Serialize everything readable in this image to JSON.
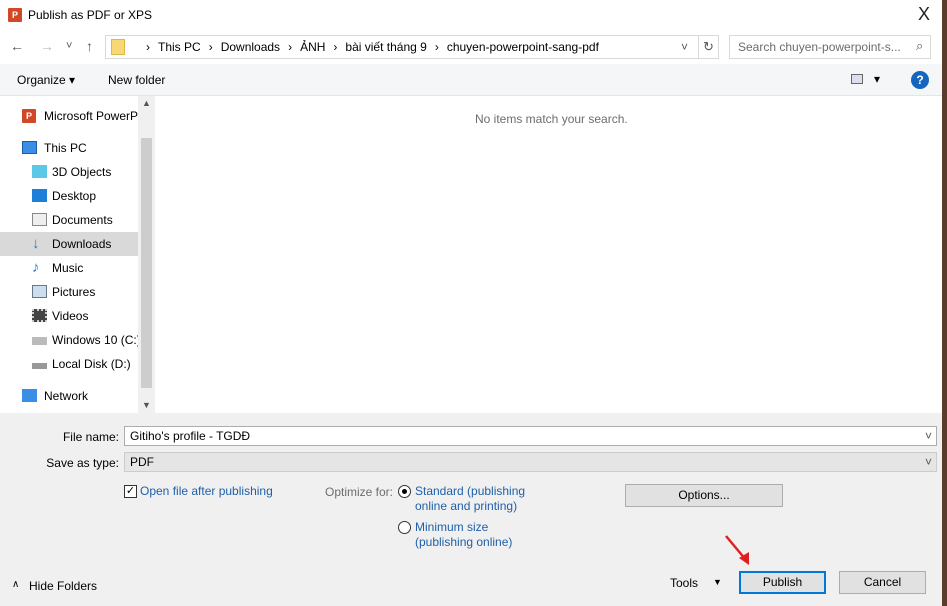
{
  "window": {
    "title": "Publish as PDF or XPS",
    "close": "X"
  },
  "nav": {
    "back": "←",
    "forward": "→",
    "recent": "˅",
    "up": "↑",
    "refresh": "↻",
    "dropdown": "˅",
    "breadcrumb": [
      "This PC",
      "Downloads",
      "ẢNH",
      "bài viết tháng 9",
      "chuyen-powerpoint-sang-pdf"
    ],
    "search_placeholder": "Search chuyen-powerpoint-s..."
  },
  "toolbar": {
    "organize": "Organize ▾",
    "new_folder": "New folder",
    "view_arrow": "▾",
    "help": "?"
  },
  "sidebar": {
    "items": [
      {
        "label": "Microsoft PowerP"
      },
      {
        "label": "This PC"
      },
      {
        "label": "3D Objects"
      },
      {
        "label": "Desktop"
      },
      {
        "label": "Documents"
      },
      {
        "label": "Downloads"
      },
      {
        "label": "Music"
      },
      {
        "label": "Pictures"
      },
      {
        "label": "Videos"
      },
      {
        "label": "Windows 10 (C:)"
      },
      {
        "label": "Local Disk (D:)"
      },
      {
        "label": "Network"
      }
    ],
    "selected": "Downloads"
  },
  "content": {
    "empty_message": "No items match your search."
  },
  "form": {
    "file_name_label": "File name:",
    "file_name": "Gitiho's profile - TGDĐ",
    "type_label": "Save as type:",
    "type": "PDF",
    "open_after": "Open file after publishing",
    "open_after_checked": true,
    "optimize_label": "Optimize for:",
    "opt_standard_1": "Standard (publishing",
    "opt_standard_2": "online and printing)",
    "opt_min_1": "Minimum size",
    "opt_min_2": "(publishing online)",
    "selected_option": "standard",
    "options": "Options...",
    "tools": "Tools",
    "publish": "Publish",
    "cancel": "Cancel",
    "hide_folders": "Hide Folders"
  },
  "colors": {
    "accent": "#0078d7",
    "link": "#1f5fa8",
    "arrow": "#e02020"
  }
}
